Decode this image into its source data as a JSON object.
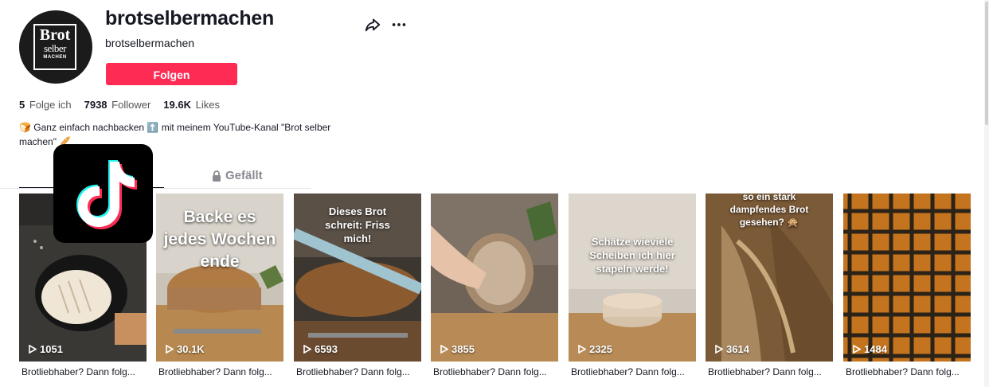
{
  "profile": {
    "username": "brotselbermachen",
    "handle": "brotselbermachen",
    "follow_label": "Folgen",
    "avatar_logo_lines": [
      "Brot",
      "selber",
      "MACHEN"
    ]
  },
  "stats": [
    {
      "value": "5",
      "label": "Folge ich"
    },
    {
      "value": "7938",
      "label": "Follower"
    },
    {
      "value": "19.6K",
      "label": "Likes"
    }
  ],
  "bio": {
    "emoji_bread": "🍞",
    "text1": "Ganz einfach nachbacken",
    "emoji_up": "⬆️",
    "text2": "mit meinem YouTube-Kanal \"Brot selber machen\"",
    "emoji_end": "🥖"
  },
  "tabs": {
    "videos_label": "",
    "liked_label": "Gefällt"
  },
  "videos": [
    {
      "views": "1051",
      "caption": "Brotliebhaber? Dann folg...",
      "overlay": ""
    },
    {
      "views": "30.1K",
      "caption": "Brotliebhaber? Dann folg...",
      "overlay": "Backe es jedes Wochen ende"
    },
    {
      "views": "6593",
      "caption": "Brotliebhaber? Dann folg...",
      "overlay": "Dieses Brot schreit: Friss mich!"
    },
    {
      "views": "3855",
      "caption": "Brotliebhaber? Dann folg...",
      "overlay": ""
    },
    {
      "views": "2325",
      "caption": "Brotliebhaber? Dann folg...",
      "overlay": "Schätze wieviele Scheiben ich hier stapeln werde!"
    },
    {
      "views": "3614",
      "caption": "Brotliebhaber? Dann folg...",
      "overlay": "so ein stark dampfendes Brot gesehen? 🙊"
    },
    {
      "views": "1484",
      "caption": "Brotliebhaber? Dann folg...",
      "overlay": ""
    }
  ],
  "colors": {
    "accent": "#fe2c55",
    "text": "#161823",
    "muted": "#8a8b91"
  },
  "icons": [
    "share-icon",
    "more-icon",
    "lock-icon",
    "play-icon",
    "tiktok-logo-icon"
  ]
}
